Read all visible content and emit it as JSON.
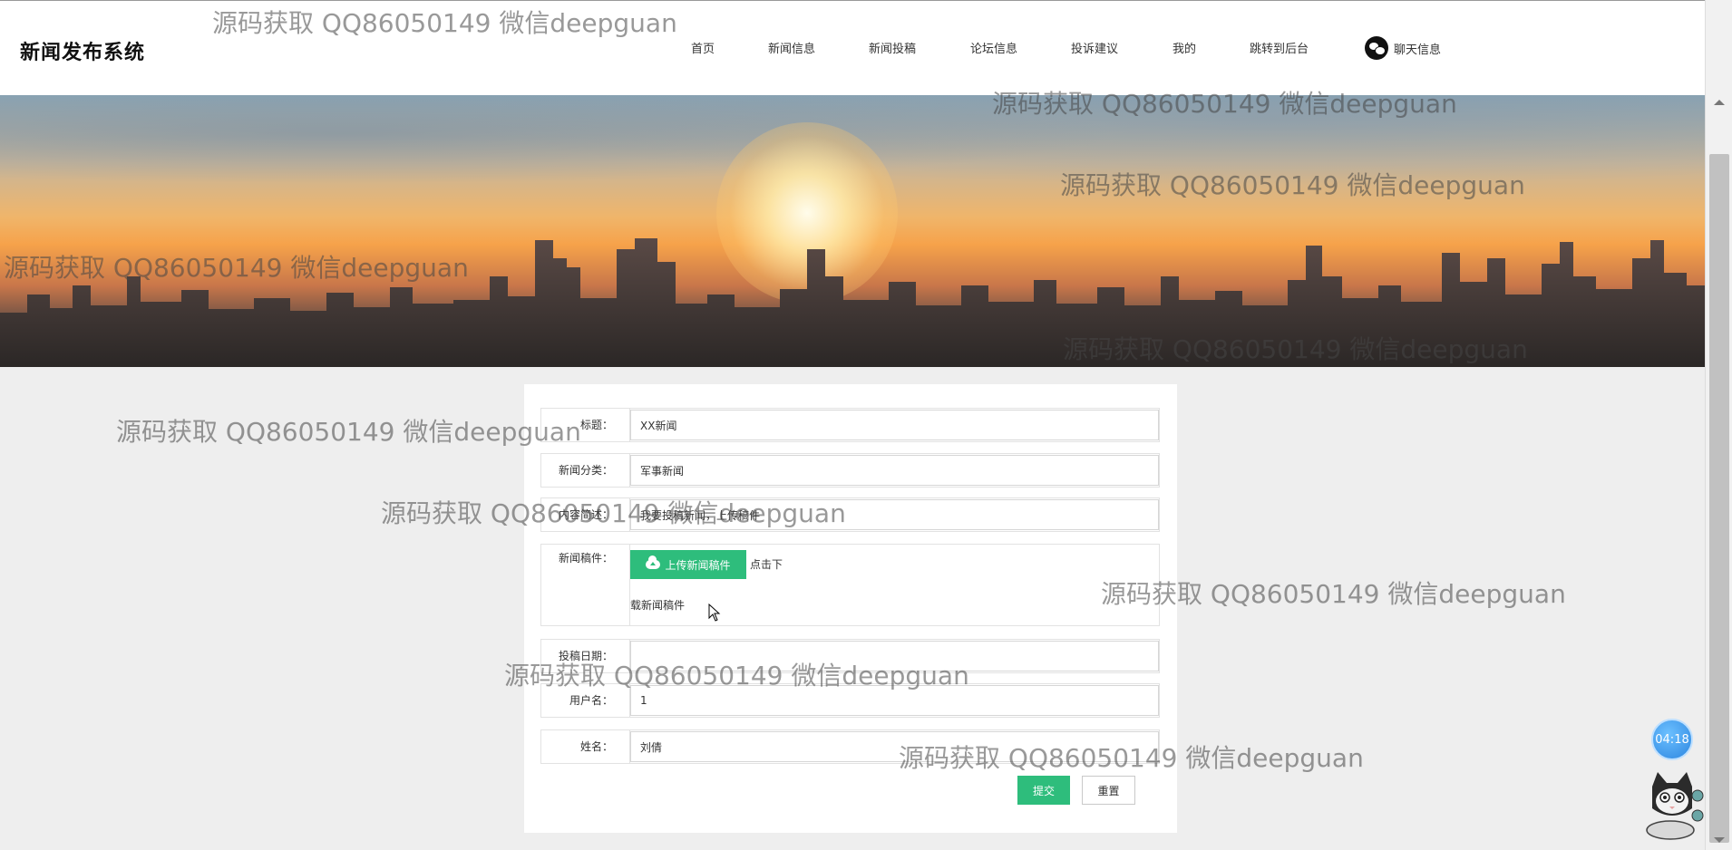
{
  "header": {
    "brand": "新闻发布系统",
    "nav": [
      {
        "label": "首页"
      },
      {
        "label": "新闻信息"
      },
      {
        "label": "新闻投稿"
      },
      {
        "label": "论坛信息"
      },
      {
        "label": "投诉建议"
      },
      {
        "label": "我的"
      },
      {
        "label": "跳转到后台"
      }
    ],
    "chat_label": "聊天信息",
    "chat_icon": "wechat-icon"
  },
  "form": {
    "fields": [
      {
        "label": "标题：",
        "value": "XX新闻"
      },
      {
        "label": "新闻分类：",
        "value": "军事新闻"
      },
      {
        "label": "内容简述：",
        "value": "我要投稿新闻，上传稿件"
      },
      {
        "label": "新闻稿件：",
        "upload_label": "上传新闻稿件",
        "download_prefix": "点击下",
        "download_suffix": "载新闻稿件"
      },
      {
        "label": "投稿日期：",
        "value": ""
      },
      {
        "label": "用户名：",
        "value": "1"
      },
      {
        "label": "姓名：",
        "value": "刘倩"
      }
    ],
    "submit_label": "提交",
    "reset_label": "重置"
  },
  "watermark": "源码获取 QQ86050149 微信deepguan",
  "timer": "04:18",
  "colors": {
    "accent": "#2ebd7c",
    "background": "#eeeeee"
  }
}
